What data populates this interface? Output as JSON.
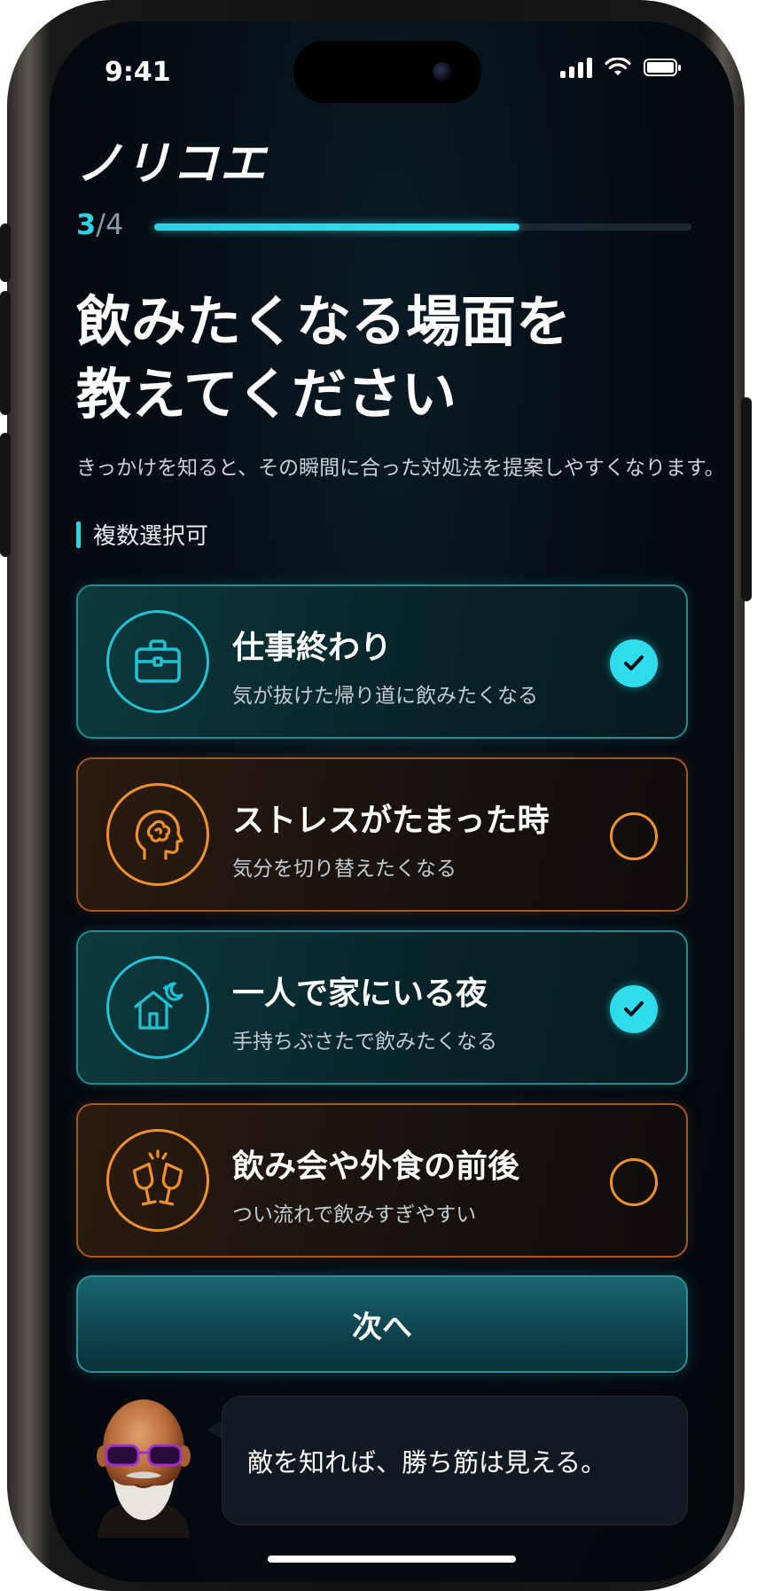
{
  "status": {
    "time": "9:41"
  },
  "app": {
    "logo": "ノリコエ"
  },
  "progress": {
    "current": "3",
    "separator": "/",
    "total": "4",
    "fraction": 0.68
  },
  "page": {
    "title_line1": "飲みたくなる場面を",
    "title_line2": "教えてください",
    "subtitle": "きっかけを知ると、その瞬間に合った対処法を提案しやすくなります。",
    "multi_label": "複数選択可"
  },
  "options": [
    {
      "title": "仕事終わり",
      "desc": "気が抜けた帰り道に飲みたくなる",
      "selected": true,
      "icon": "briefcase-icon"
    },
    {
      "title": "ストレスがたまった時",
      "desc": "気分を切り替えたくなる",
      "selected": false,
      "icon": "stressed-head-icon"
    },
    {
      "title": "一人で家にいる夜",
      "desc": "手持ちぶさたで飲みたくなる",
      "selected": true,
      "icon": "house-moon-icon"
    },
    {
      "title": "飲み会や外食の前後",
      "desc": "つい流れで飲みすぎやすい",
      "selected": false,
      "icon": "toast-glasses-icon"
    }
  ],
  "next_button": {
    "label": "次へ"
  },
  "coach": {
    "message": "敵を知れば、勝ち筋は見える。"
  },
  "colors": {
    "accent": "#2ED3E6",
    "orange": "#F0922C",
    "background": "#050B12"
  }
}
